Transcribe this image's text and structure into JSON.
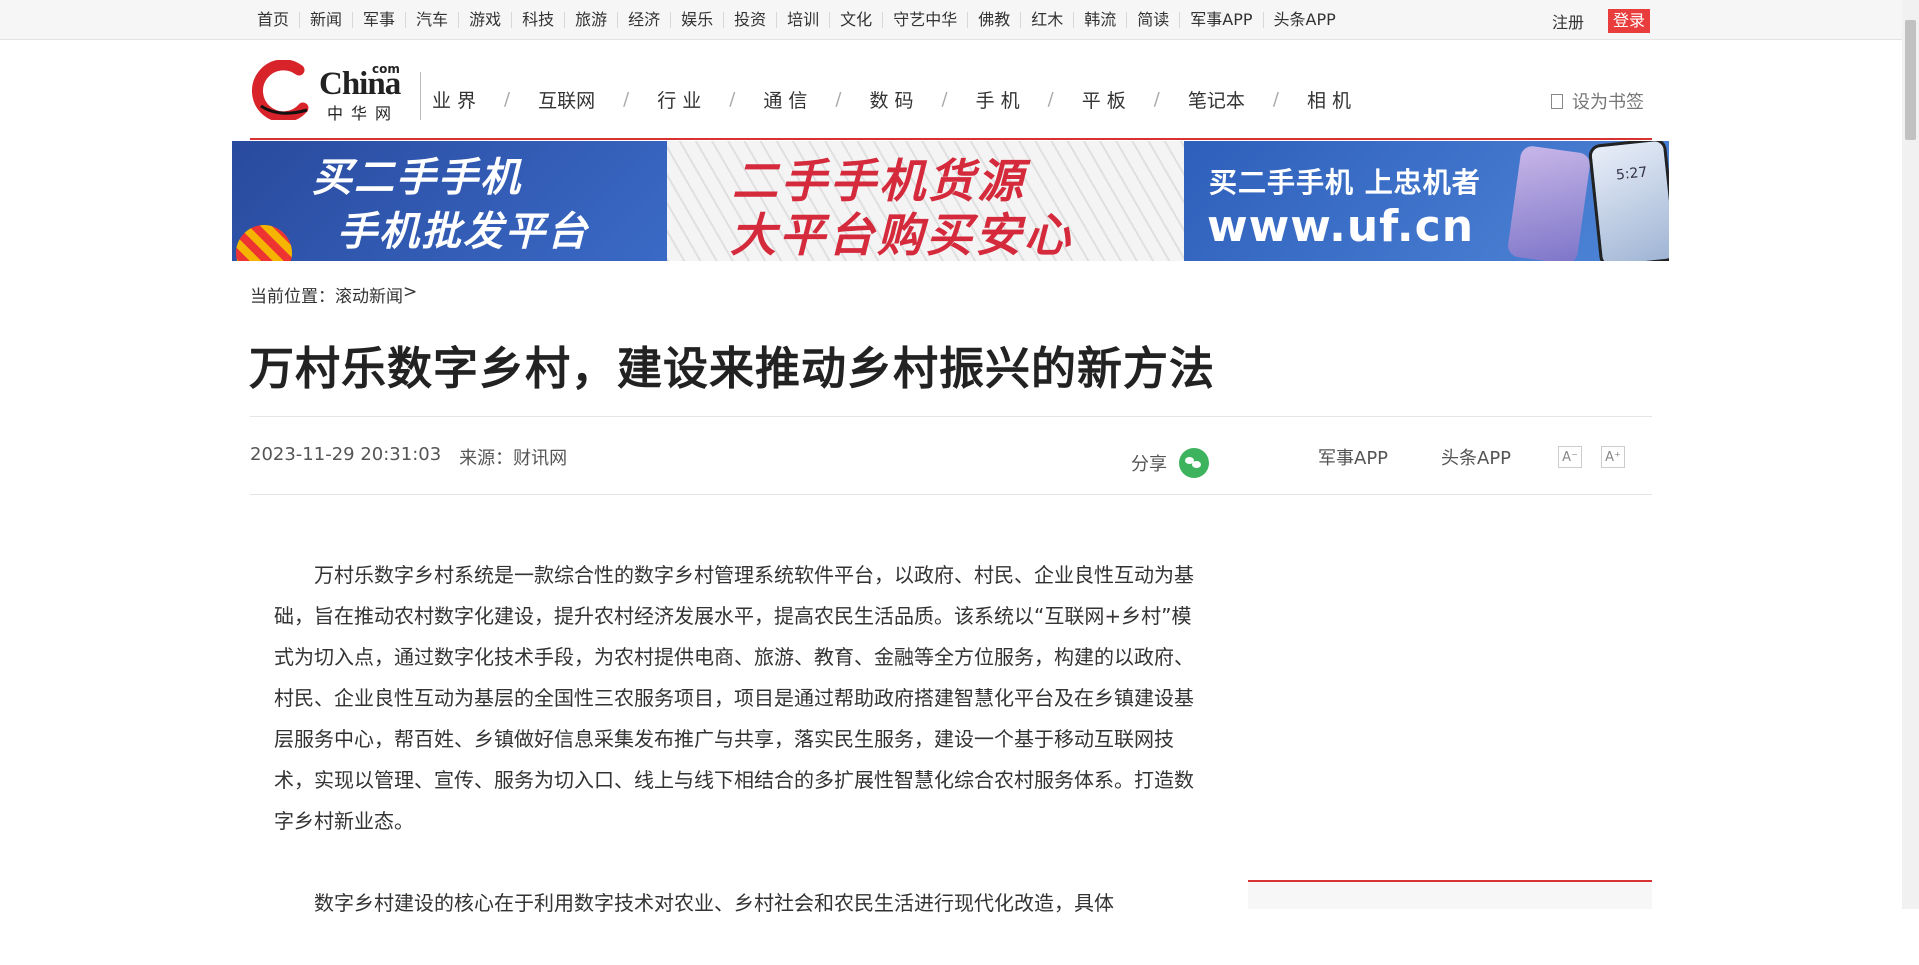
{
  "topnav": [
    "首页",
    "新闻",
    "军事",
    "汽车",
    "游戏",
    "科技",
    "旅游",
    "经济",
    "娱乐",
    "投资",
    "培训",
    "文化",
    "守艺中华",
    "佛教",
    "红木",
    "韩流",
    "简读",
    "军事APP",
    "头条APP"
  ],
  "account": {
    "register": "注册",
    "login": "登录"
  },
  "logo": {
    "en": "China",
    "com": "com",
    "cn": "中华网"
  },
  "mainnav": [
    "业 界",
    "互联网",
    "行 业",
    "通 信",
    "数 码",
    "手 机",
    "平 板",
    "笔记本",
    "相 机"
  ],
  "bookmark": "设为书签",
  "banner": {
    "left_line1": "买二手手机",
    "left_line2": "手机批发平台",
    "mid_line1": "二手手机货源",
    "mid_line2": "大平台购买安心",
    "right_line1": "买二手手机 上忠机者",
    "right_line2": "www.uf.cn",
    "phone_time": "5:27"
  },
  "breadcrumb": {
    "prefix": "当前位置：",
    "link": "滚动新闻",
    "suffix": ">"
  },
  "article": {
    "title": "万村乐数字乡村，建设来推动乡村振兴的新方法",
    "datetime": "2023-11-29 20:31:03",
    "source": "来源：财讯网",
    "share_label": "分享",
    "app1": "军事APP",
    "app2": "头条APP",
    "font_smaller": "A⁻",
    "font_larger": "A⁺",
    "paragraphs": [
      "万村乐数字乡村系统是一款综合性的数字乡村管理系统软件平台，以政府、村民、企业良性互动为基础，旨在推动农村数字化建设，提升农村经济发展水平，提高农民生活品质。该系统以“互联网+乡村”模式为切入点，通过数字化技术手段，为农村提供电商、旅游、教育、金融等全方位服务，构建的以政府、村民、企业良性互动为基层的全国性三农服务项目，项目是通过帮助政府搭建智慧化平台及在乡镇建设基层服务中心，帮百姓、乡镇做好信息采集发布推广与共享，落实民生服务，建设一个基于移动互联网技术，实现以管理、宣传、服务为切入口、线上与线下相结合的多扩展性智慧化综合农村服务体系。打造数字乡村新业态。",
      "数字乡村建设的核心在于利用数字技术对农业、乡村社会和农民生活进行现代化改造，具体"
    ]
  },
  "colors": {
    "accent_red": "#d83232",
    "login_red": "#e93c3c",
    "wechat_green": "#3eb35e"
  }
}
